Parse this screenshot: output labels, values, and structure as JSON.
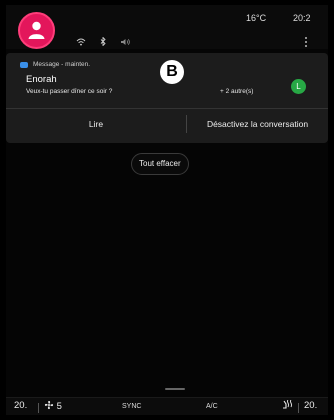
{
  "status_bar": {
    "temperature": "16°C",
    "time": "20:2",
    "icons": [
      "wifi-icon",
      "bluetooth-icon",
      "volume-icon"
    ]
  },
  "notification": {
    "app_label": "Message - mainten.",
    "sender": "Enorah",
    "message": "Veux-tu passer dîner ce soir ?",
    "more": "+ 2 autre(s)",
    "contact_initial": "L",
    "marker": "B",
    "actions": {
      "read": "Lire",
      "mute": "Désactivez la conversation"
    }
  },
  "clear_all_label": "Tout effacer",
  "climate_bar": {
    "left_temp": "20.",
    "fan_level": "5",
    "sync": "SYNC",
    "ac": "A/C",
    "right_temp": "20."
  },
  "colors": {
    "avatar": "#e3165b",
    "contact_avatar": "#27a845",
    "message_icon": "#3a8fe8"
  }
}
